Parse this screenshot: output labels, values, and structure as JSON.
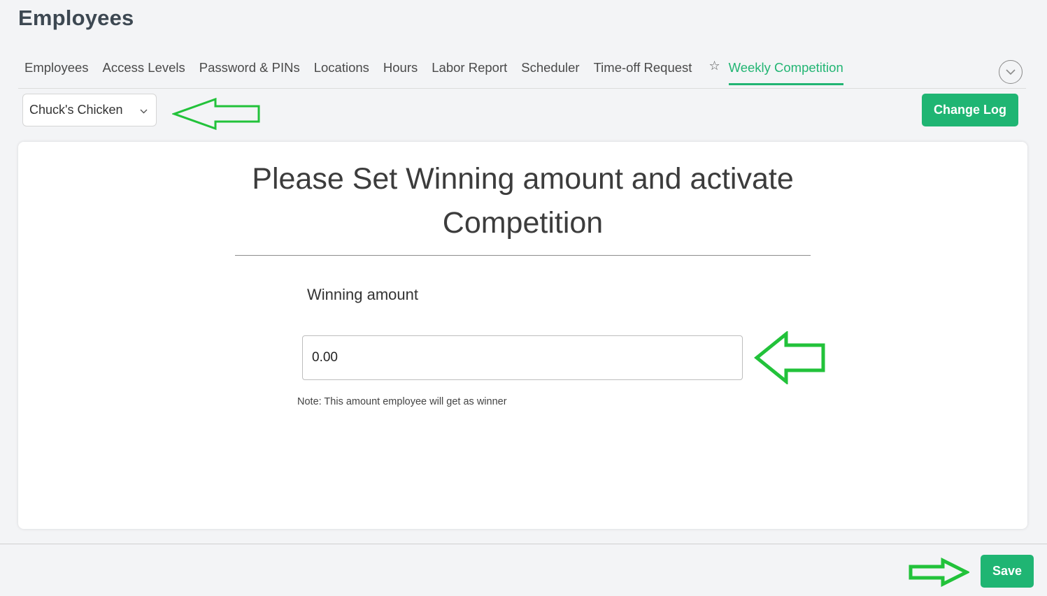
{
  "page": {
    "title": "Employees"
  },
  "tabs": [
    {
      "label": "Employees"
    },
    {
      "label": "Access Levels"
    },
    {
      "label": "Password & PINs"
    },
    {
      "label": "Locations"
    },
    {
      "label": "Hours"
    },
    {
      "label": "Labor Report"
    },
    {
      "label": "Scheduler"
    },
    {
      "label": "Time-off Request"
    },
    {
      "label": "Weekly Competition",
      "active": true,
      "icon": "star-icon"
    }
  ],
  "toolbar": {
    "location_select": {
      "value": "Chuck's Chicken",
      "icon": "chevron-down-icon"
    },
    "change_log_label": "Change Log",
    "collapse_icon": "chevron-down-circle-icon"
  },
  "card": {
    "heading_line1": "Please Set Winning amount and activate",
    "heading_line2": "Competition",
    "winning_amount_label": "Winning amount",
    "winning_amount_value": "0.00",
    "note": "Note: This amount employee will get as winner"
  },
  "footer": {
    "save_label": "Save"
  },
  "colors": {
    "accent": "#1fb573",
    "annotation_arrow": "#22c23a"
  }
}
